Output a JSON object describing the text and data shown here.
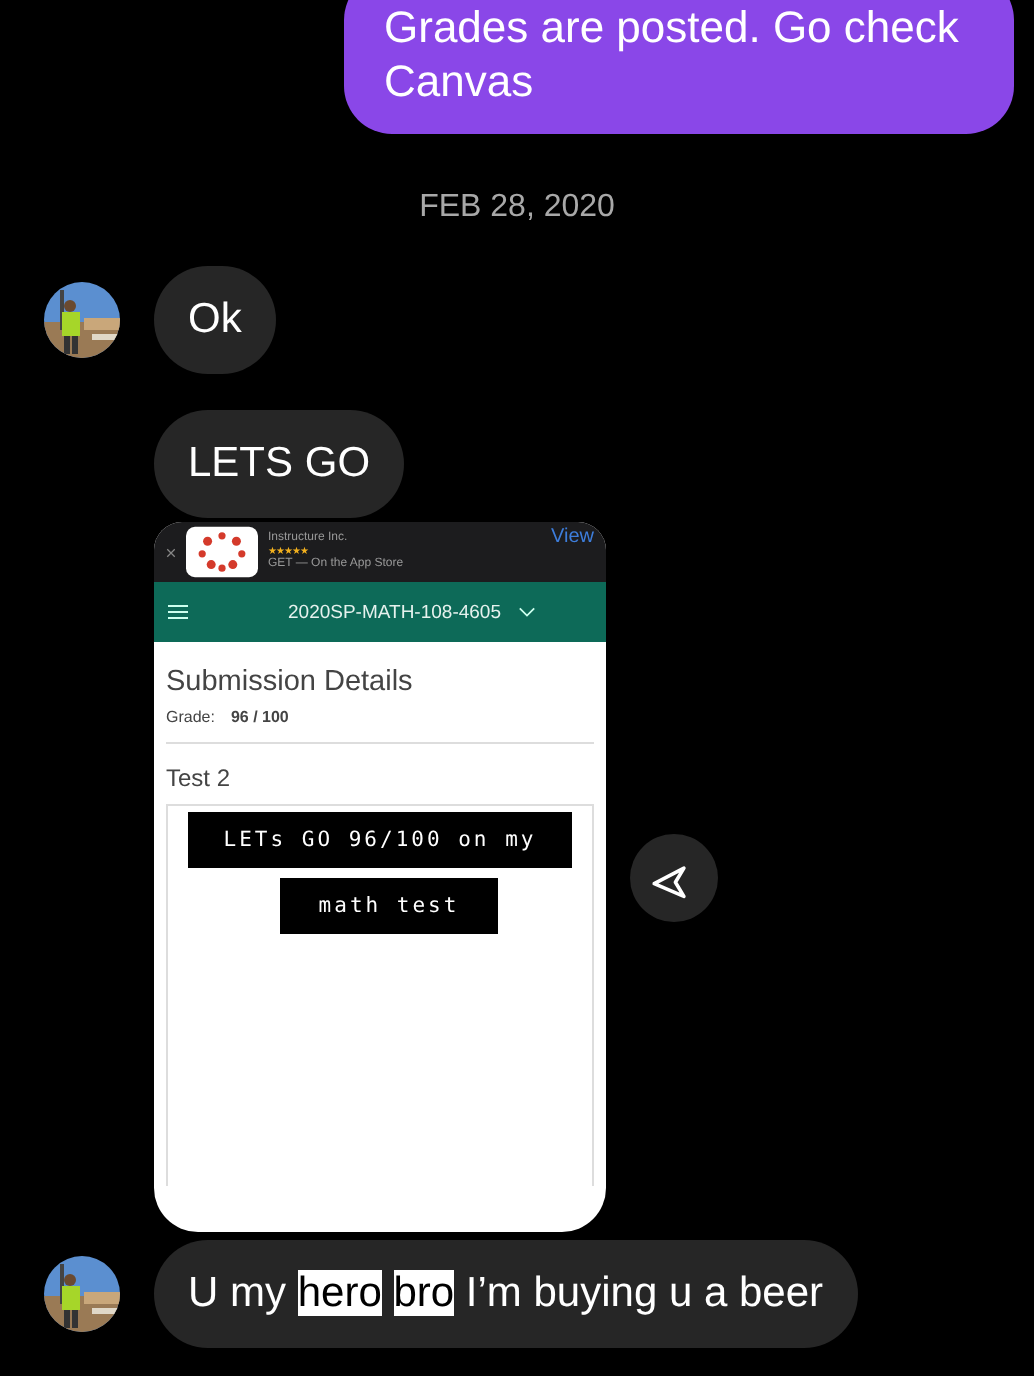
{
  "messages": [
    {
      "kind": "outgoing",
      "text": "Grades are posted. Go check Canvas"
    },
    {
      "kind": "date",
      "text": "FEB 28, 2020"
    },
    {
      "kind": "incoming",
      "avatar": true,
      "text": "Ok"
    },
    {
      "kind": "incoming",
      "avatar": false,
      "text": "LETS GO"
    },
    {
      "kind": "screenshot",
      "avatar": false,
      "shot": {
        "app_name": "Instructure Inc.",
        "stars": "★★★★★",
        "get": "GET — On the App Store",
        "view": "View",
        "course": "2020SP-MATH-108-4605",
        "heading": "Submission Details",
        "grade_label": "Grade:",
        "grade": "96 / 100",
        "assignment": "Test 2",
        "stickers": [
          "LETs GO 96/100 on my",
          "math test"
        ]
      }
    },
    {
      "kind": "incoming",
      "avatar": true,
      "segments": [
        {
          "text": "U my",
          "highlighted": false
        },
        {
          "text": "hero",
          "highlighted": true
        },
        {
          "text": "bro",
          "highlighted": true
        },
        {
          "text": "I’m buying u a beer",
          "highlighted": false
        }
      ]
    }
  ]
}
